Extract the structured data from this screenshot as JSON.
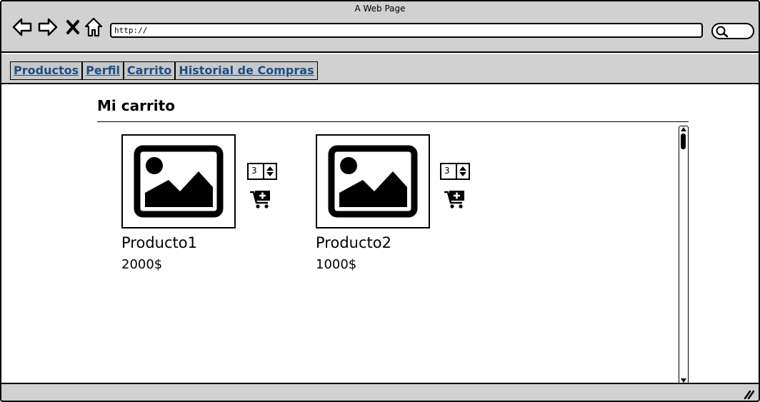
{
  "window": {
    "title": "A Web Page"
  },
  "address_bar": {
    "value": "http://"
  },
  "menu": {
    "items": [
      {
        "label": "Productos"
      },
      {
        "label": "Perfil"
      },
      {
        "label": "Carrito"
      },
      {
        "label": "Historial de Compras"
      }
    ]
  },
  "page": {
    "heading": "Mi carrito"
  },
  "products": [
    {
      "name": "Producto1",
      "price": "2000$",
      "quantity": "3"
    },
    {
      "name": "Producto2",
      "price": "1000$",
      "quantity": "3"
    }
  ],
  "icons": {
    "back": "back-arrow-icon",
    "forward": "forward-arrow-icon",
    "stop": "close-icon",
    "home": "home-icon",
    "search": "search-icon",
    "image": "image-placeholder-icon",
    "cart": "add-to-cart-icon"
  }
}
